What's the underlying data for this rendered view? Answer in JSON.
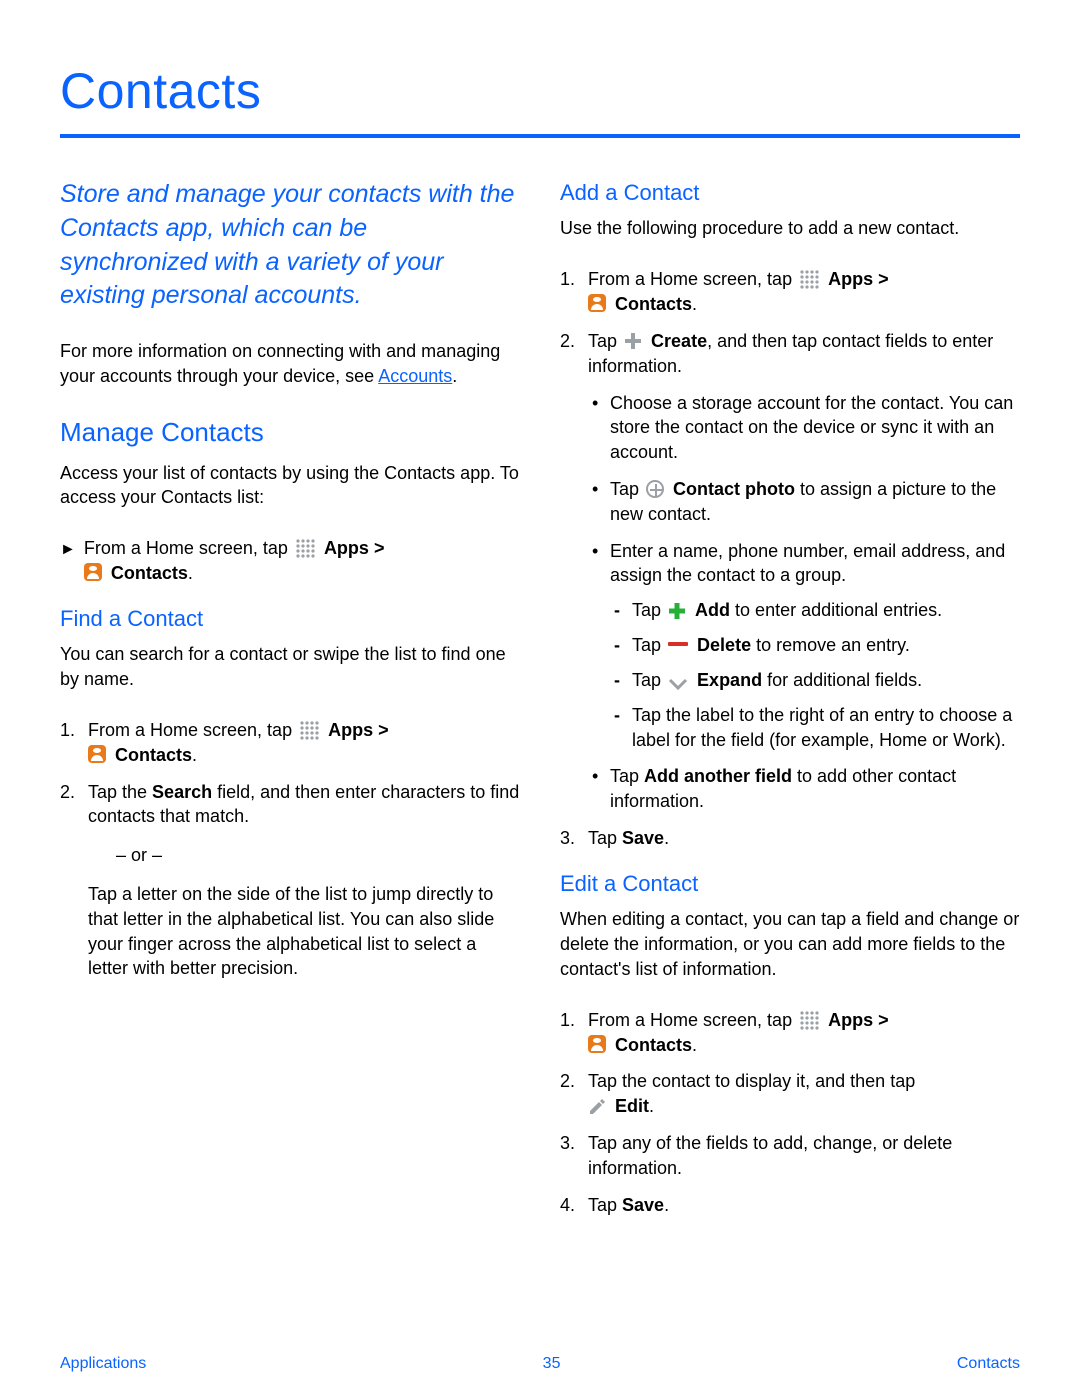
{
  "title": "Contacts",
  "intro": "Store and manage your contacts with the Contacts app, which can be synchronized with a variety of your existing personal accounts.",
  "more_info_prefix": "For more information on connecting with and managing your accounts through your device, see ",
  "accounts_link": "Accounts",
  "period": ".",
  "manage": {
    "heading": "Manage Contacts",
    "desc": "Access your list of contacts by using the Contacts app. To access your Contacts list:",
    "from_home_prefix": "From a Home screen, tap ",
    "apps_label": "Apps",
    "gt": " > ",
    "contacts_label": "Contacts"
  },
  "find": {
    "heading": "Find a Contact",
    "desc": "You can search for a contact or swipe the list to find one by name.",
    "step1_prefix": "From a Home screen, tap ",
    "step2_a": "Tap the ",
    "step2_search": "Search",
    "step2_b": " field, and then enter characters to find contacts that match.",
    "or": "– or –",
    "alt": "Tap a letter on the side of the list to jump directly to that letter in the alphabetical list. You can also slide your finger across the alphabetical list to select a letter with better precision."
  },
  "add": {
    "heading": "Add a Contact",
    "desc": "Use the following procedure to add a new contact.",
    "step1_prefix": "From a Home screen, tap ",
    "step2_a": "Tap ",
    "step2_create": "Create",
    "step2_b": ", and then tap contact fields to enter information.",
    "bul1": "Choose a storage account for the contact. You can store the contact on the device or sync it with an account.",
    "bul2_a": "Tap ",
    "bul2_b": "Contact photo",
    "bul2_c": " to assign a picture to the new contact.",
    "bul3": "Enter a name, phone number, email address, and assign the contact to a group.",
    "d1_a": "Tap ",
    "d1_b": "Add",
    "d1_c": " to enter additional entries.",
    "d2_a": "Tap ",
    "d2_b": "Delete",
    "d2_c": " to remove an entry.",
    "d3_a": "Tap ",
    "d3_b": "Expand",
    "d3_c": " for additional fields.",
    "d4": "Tap the label to the right of an entry to choose a label for the field (for example, Home or Work).",
    "bul4_a": "Tap ",
    "bul4_b": "Add another field",
    "bul4_c": " to add other contact information.",
    "step3_a": "Tap ",
    "step3_b": "Save"
  },
  "edit": {
    "heading": "Edit a Contact",
    "desc": "When editing a contact, you can tap a field and change or delete the information, or you can add more fields to the contact's list of information.",
    "step1_prefix": "From a Home screen, tap ",
    "step2": "Tap the contact to display it, and then tap ",
    "edit_label": "Edit",
    "step3": "Tap any of the fields to add, change, or delete information.",
    "step4_a": "Tap ",
    "step4_b": "Save"
  },
  "footer": {
    "left": "Applications",
    "center": "35",
    "right": "Contacts"
  }
}
